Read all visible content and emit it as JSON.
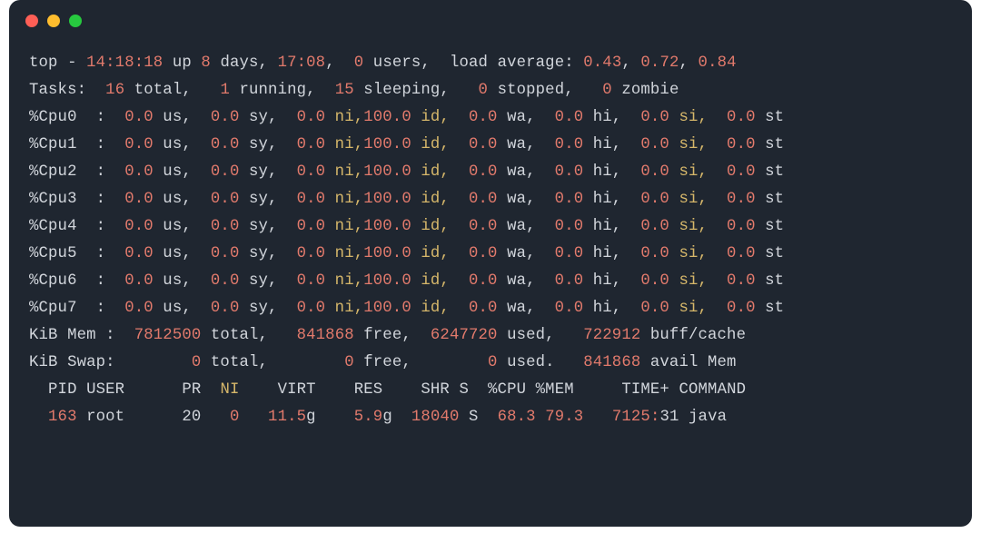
{
  "uptime": {
    "prefix": "top - ",
    "time": "14:18:18",
    "up_label": " up ",
    "days_num": "8",
    "days_label": " days, ",
    "uptime_hm": "17:08",
    "users_sep": ",  ",
    "users_num": "0",
    "users_label": " users,  load average: ",
    "la1": "0.43",
    "la_sep1": ", ",
    "la2": "0.72",
    "la_sep2": ", ",
    "la3": "0.84"
  },
  "tasks": {
    "label": "Tasks:  ",
    "total_n": "16",
    "total_l": " total,   ",
    "run_n": "1",
    "run_l": " running,  ",
    "sleep_n": "15",
    "sleep_l": " sleeping,   ",
    "stop_n": "0",
    "stop_l": " stopped,   ",
    "zomb_n": "0",
    "zomb_l": " zombie"
  },
  "cpus": [
    {
      "name": "%Cpu0  :  ",
      "us": "0.0",
      "sy": "0.0",
      "ni": "0.0",
      "id": "100.0",
      "wa": "0.0",
      "hi": "0.0",
      "si": "0.0",
      "st": "0.0"
    },
    {
      "name": "%Cpu1  :  ",
      "us": "0.0",
      "sy": "0.0",
      "ni": "0.0",
      "id": "100.0",
      "wa": "0.0",
      "hi": "0.0",
      "si": "0.0",
      "st": "0.0"
    },
    {
      "name": "%Cpu2  :  ",
      "us": "0.0",
      "sy": "0.0",
      "ni": "0.0",
      "id": "100.0",
      "wa": "0.0",
      "hi": "0.0",
      "si": "0.0",
      "st": "0.0"
    },
    {
      "name": "%Cpu3  :  ",
      "us": "0.0",
      "sy": "0.0",
      "ni": "0.0",
      "id": "100.0",
      "wa": "0.0",
      "hi": "0.0",
      "si": "0.0",
      "st": "0.0"
    },
    {
      "name": "%Cpu4  :  ",
      "us": "0.0",
      "sy": "0.0",
      "ni": "0.0",
      "id": "100.0",
      "wa": "0.0",
      "hi": "0.0",
      "si": "0.0",
      "st": "0.0"
    },
    {
      "name": "%Cpu5  :  ",
      "us": "0.0",
      "sy": "0.0",
      "ni": "0.0",
      "id": "100.0",
      "wa": "0.0",
      "hi": "0.0",
      "si": "0.0",
      "st": "0.0"
    },
    {
      "name": "%Cpu6  :  ",
      "us": "0.0",
      "sy": "0.0",
      "ni": "0.0",
      "id": "100.0",
      "wa": "0.0",
      "hi": "0.0",
      "si": "0.0",
      "st": "0.0"
    },
    {
      "name": "%Cpu7  :  ",
      "us": "0.0",
      "sy": "0.0",
      "ni": "0.0",
      "id": "100.0",
      "wa": "0.0",
      "hi": "0.0",
      "si": "0.0",
      "st": "0.0"
    }
  ],
  "cpu_labels": {
    "us": " us,  ",
    "sy": " sy,  ",
    "ni": " ni,",
    "id": " id,  ",
    "wa": " wa,  ",
    "hi": " hi,  ",
    "si": " si,  ",
    "st": " st"
  },
  "mem": {
    "label": "KiB Mem :  ",
    "total_n": "7812500",
    "total_l": " total,   ",
    "free_n": "841868",
    "free_l": " free,  ",
    "used_n": "6247720",
    "used_l": " used,   ",
    "cache_n": "722912",
    "cache_l": " buff/cache"
  },
  "swap": {
    "label": "KiB Swap:        ",
    "total_n": "0",
    "total_l": " total,        ",
    "free_n": "0",
    "free_l": " free,        ",
    "used_n": "0",
    "used_l": " used.   ",
    "avail_n": "841868",
    "avail_l": " avail Mem"
  },
  "header": {
    "pid": "  PID ",
    "user": "USER      ",
    "pr": "PR  ",
    "ni": "NI",
    "virt": "    VIRT",
    "res": "    RES",
    "shr": "    SHR ",
    "s": "S  ",
    "cpu": "%CPU ",
    "mem": "%MEM",
    "time": "     TIME+ ",
    "cmd": "COMMAND"
  },
  "proc": {
    "pid": "  163 ",
    "user": "root      ",
    "pr": "20",
    "ni": "   0",
    "virt": "   11.5",
    "virt_g": "g",
    "res": "    5.9",
    "res_g": "g",
    "shr": "  18040 ",
    "s": "S  ",
    "cpu": "68.3 ",
    "mem": "79.3",
    "time_a": "   7125:",
    "time_b": "31 ",
    "cmd": "java"
  }
}
